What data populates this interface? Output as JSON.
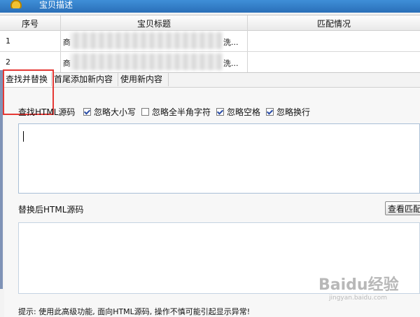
{
  "window": {
    "title": "宝贝描述"
  },
  "grid": {
    "headers": [
      "序号",
      "宝贝标题",
      "匹配情况"
    ],
    "rows": [
      {
        "index": "1",
        "title_start": "商",
        "title_end": "洗..."
      },
      {
        "index": "2",
        "title_start": "商",
        "title_end": "洗..."
      }
    ]
  },
  "tabs": [
    {
      "label": "查找并替换",
      "selected": true
    },
    {
      "label": "首尾添加新内容",
      "selected": false
    },
    {
      "label": "使用新内容",
      "selected": false
    }
  ],
  "find": {
    "label": "查找HTML源码",
    "options": [
      {
        "label": "忽略大小写",
        "checked": true
      },
      {
        "label": "忽略全半角字符",
        "checked": false
      },
      {
        "label": "忽略空格",
        "checked": true
      },
      {
        "label": "忽略换行",
        "checked": true
      }
    ],
    "value": ""
  },
  "replace": {
    "label": "替换后HTML源码",
    "view_match_button": "查看匹配",
    "value": ""
  },
  "tip": "提示: 使用此高级功能, 面向HTML源码, 操作不慎可能引起显示异常!",
  "watermark": {
    "brand": "Baidu经验",
    "url": "jingyan.baidu.com"
  },
  "colors": {
    "highlight": "#e53935",
    "title_bar": "#2a6fb8"
  }
}
